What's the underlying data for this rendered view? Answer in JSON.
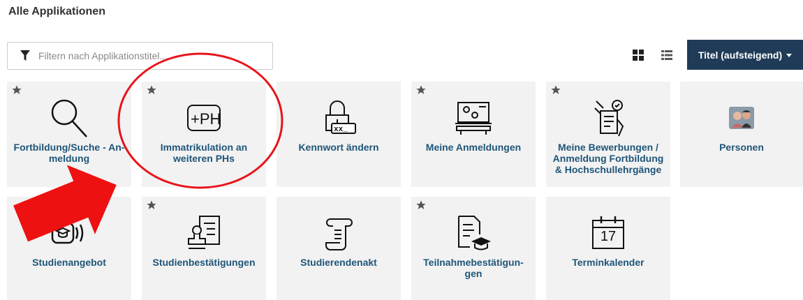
{
  "page": {
    "title": "Alle Applikationen"
  },
  "filter": {
    "placeholder": "Filtern nach Applikationstitel...",
    "icon": "filter-icon"
  },
  "view": {
    "grid_icon": "grid-view-icon",
    "list_icon": "list-view-icon"
  },
  "sort": {
    "label": "Titel (aufsteigend)"
  },
  "tiles": [
    {
      "label": "Fortbildung/Suche - An-\nmeldung",
      "icon": "search-icon",
      "starred": true
    },
    {
      "label": "Immatrikulation an weiteren PHs",
      "icon": "ph-icon",
      "starred": true
    },
    {
      "label": "Kennwort ändern",
      "icon": "password-lock-icon",
      "starred": false
    },
    {
      "label": "Meine Anmeldungen",
      "icon": "presentation-board-icon",
      "starred": true
    },
    {
      "label": "Meine Bewerbungen / Anmeldung Fortbildung & Hochschullehrgänge",
      "icon": "application-form-icon",
      "starred": true
    },
    {
      "label": "Personen",
      "icon": "persons-icon",
      "starred": false
    },
    {
      "label": "Studienangebot",
      "icon": "study-offer-icon",
      "starred": false
    },
    {
      "label": "Studienbestätigungen",
      "icon": "confirmation-stamp-icon",
      "starred": true
    },
    {
      "label": "Studierendenakt",
      "icon": "scroll-icon",
      "starred": false
    },
    {
      "label": "Teilnahmebestätigun-\ngen",
      "icon": "participation-document-icon",
      "starred": true
    },
    {
      "label": "Terminkalender",
      "icon": "calendar-icon",
      "starred": false,
      "calendar_day": "17"
    }
  ],
  "annotations": {
    "circle_color": "#e8141b",
    "arrow_color": "#ee1111"
  },
  "colors": {
    "tile_bg": "#f2f2f2",
    "label": "#1e5578",
    "sort_bg": "#1f3b57"
  }
}
